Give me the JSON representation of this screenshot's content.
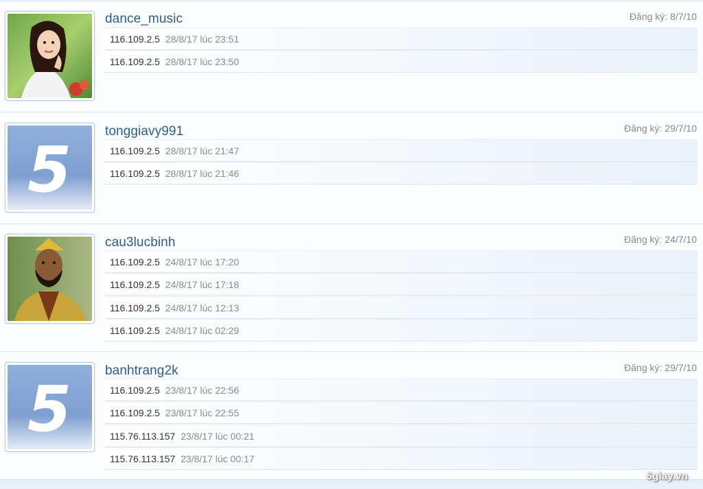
{
  "members": [
    {
      "username": "dance_music",
      "joined_label": "Đăng ký:",
      "joined_date": "8/7/10",
      "avatar": "photo-girl-avatar",
      "logins": [
        {
          "ip": "116.109.2.5",
          "time": "28/8/17 lúc 23:51"
        },
        {
          "ip": "116.109.2.5",
          "time": "28/8/17 lúc 23:50"
        }
      ]
    },
    {
      "username": "tonggiavy991",
      "joined_label": "Đăng ký:",
      "joined_date": "29/7/10",
      "avatar": "default-5-avatar",
      "logins": [
        {
          "ip": "116.109.2.5",
          "time": "28/8/17 lúc 21:47"
        },
        {
          "ip": "116.109.2.5",
          "time": "28/8/17 lúc 21:46"
        }
      ]
    },
    {
      "username": "cau3lucbinh",
      "joined_label": "Đăng ký:",
      "joined_date": "24/7/10",
      "avatar": "photo-man-avatar",
      "logins": [
        {
          "ip": "116.109.2.5",
          "time": "24/8/17 lúc 17:20"
        },
        {
          "ip": "116.109.2.5",
          "time": "24/8/17 lúc 17:18"
        },
        {
          "ip": "116.109.2.5",
          "time": "24/8/17 lúc 12:13"
        },
        {
          "ip": "116.109.2.5",
          "time": "24/8/17 lúc 02:29"
        }
      ]
    },
    {
      "username": "banhtrang2k",
      "joined_label": "Đăng ký:",
      "joined_date": "29/7/10",
      "avatar": "default-5-avatar",
      "logins": [
        {
          "ip": "116.109.2.5",
          "time": "23/8/17 lúc 22:56"
        },
        {
          "ip": "116.109.2.5",
          "time": "23/8/17 lúc 22:55"
        },
        {
          "ip": "115.76.113.157",
          "time": "23/8/17 lúc 00:21"
        },
        {
          "ip": "115.76.113.157",
          "time": "23/8/17 lúc 00:17"
        }
      ]
    }
  ],
  "watermark": "5giay.vn",
  "colors": {
    "username": "#2b5d8f",
    "muted": "#8a8a8a",
    "row_border": "#d9e5f1",
    "avatar_border": "#b9cde4"
  }
}
